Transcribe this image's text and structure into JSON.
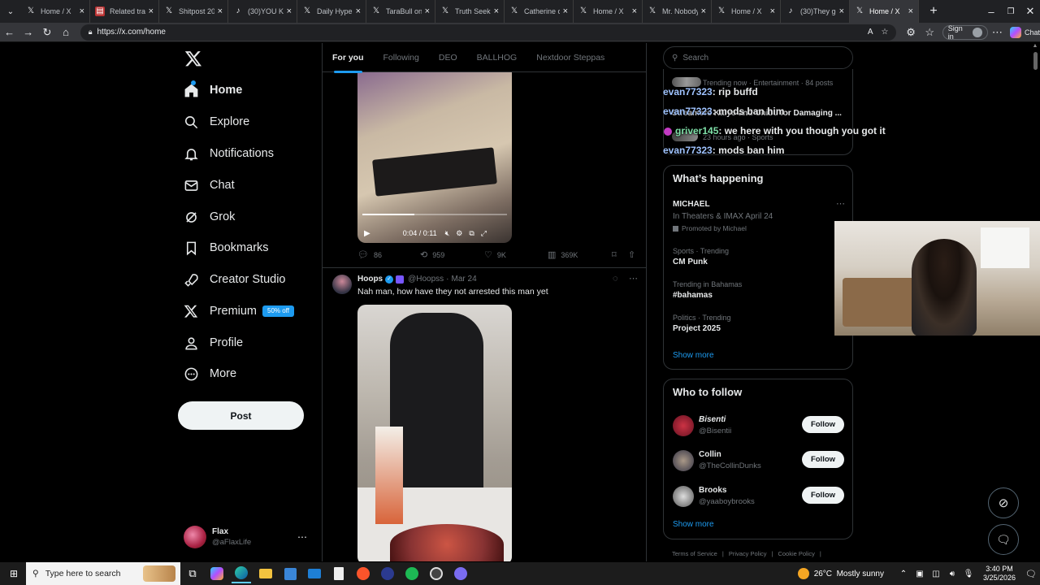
{
  "browser": {
    "tabs": [
      {
        "title": "Home / X",
        "icon": "x-logo-icon"
      },
      {
        "title": "Related track",
        "icon": "page-icon"
      },
      {
        "title": "Shitpost 207",
        "icon": "x-logo-icon"
      },
      {
        "title": "(30)YOU KNO",
        "icon": "tiktok-icon"
      },
      {
        "title": "Daily Hyperp",
        "icon": "x-logo-icon"
      },
      {
        "title": "TaraBull on X",
        "icon": "x-logo-icon"
      },
      {
        "title": "Truth Seeker",
        "icon": "x-logo-icon"
      },
      {
        "title": "Catherine on",
        "icon": "x-logo-icon"
      },
      {
        "title": "Home / X",
        "icon": "x-logo-icon"
      },
      {
        "title": "Mr. Nobody",
        "icon": "x-logo-icon"
      },
      {
        "title": "Home / X",
        "icon": "x-logo-icon"
      },
      {
        "title": "(30)They got",
        "icon": "tiktok-icon"
      },
      {
        "title": "Home / X",
        "icon": "x-logo-icon",
        "active": true
      }
    ],
    "url": "https://x.com/home",
    "sign_in": "Sign in",
    "chat": "Chat"
  },
  "nav": {
    "items": [
      {
        "label": "Home",
        "icon": "home-icon"
      },
      {
        "label": "Explore",
        "icon": "search-icon"
      },
      {
        "label": "Notifications",
        "icon": "bell-icon"
      },
      {
        "label": "Chat",
        "icon": "mail-icon"
      },
      {
        "label": "Grok",
        "icon": "grok-icon"
      },
      {
        "label": "Bookmarks",
        "icon": "bookmark-icon"
      },
      {
        "label": "Creator Studio",
        "icon": "rocket-icon"
      },
      {
        "label": "Premium",
        "icon": "x-logo-icon"
      },
      {
        "label": "Profile",
        "icon": "person-icon"
      },
      {
        "label": "More",
        "icon": "more-circle-icon"
      }
    ],
    "premium_badge": "50% off",
    "post_label": "Post",
    "account": {
      "name": "Flax",
      "handle": "@aFlaxLife"
    }
  },
  "feed": {
    "tabs": [
      "For you",
      "Following",
      "DEO",
      "BALLHOG",
      "Nextdoor Steppas"
    ],
    "video": {
      "time": "0:04 / 0:11",
      "progress": 0.36
    },
    "tweet1_actions": {
      "replies": "86",
      "reposts": "959",
      "likes": "9K",
      "views": "369K"
    },
    "tweet2": {
      "name": "Hoops",
      "handle": "@Hoopss",
      "date": "Mar 24",
      "text": "Nah man, how have they not arrested this man yet"
    }
  },
  "right": {
    "search_placeholder": "Search",
    "top_trend": {
      "meta": "Trending now · Entertainment · 84 posts",
      "title": "Streamers Kaiyo and Chibu for Damaging ...",
      "sub_meta": "23 hours ago · Sports"
    },
    "happening": {
      "title": "What’s happening",
      "promo": {
        "name": "MICHAEL",
        "line": "In Theaters & IMAX April 24",
        "promoted": "Promoted by Michael"
      },
      "trends": [
        {
          "meta": "Sports · Trending",
          "name": "CM Punk"
        },
        {
          "meta": "Trending in Bahamas",
          "name": "#bahamas"
        },
        {
          "meta": "Politics · Trending",
          "name": "Project 2025"
        }
      ],
      "show_more": "Show more"
    },
    "follow": {
      "title": "Who to follow",
      "users": [
        {
          "name": "Bisenti",
          "handle": "@Bisentii"
        },
        {
          "name": "Collin",
          "handle": "@TheCollinDunks"
        },
        {
          "name": "Brooks",
          "handle": "@yaaboybrooks"
        }
      ],
      "button": "Follow",
      "show_more": "Show more"
    },
    "footer": [
      "Terms of Service",
      "Privacy Policy",
      "Cookie Policy"
    ]
  },
  "stream_chat": [
    {
      "user": "evan77323",
      "msg": "rip buffd"
    },
    {
      "user": "evan77323",
      "msg": "mods ban him"
    },
    {
      "user": "griver145",
      "msg": "we here with you though you got it"
    },
    {
      "user": "evan77323",
      "msg": "mods ban him"
    }
  ],
  "taskbar": {
    "search_placeholder": "Type here to search",
    "weather": "26°C  Mostly sunny",
    "time": "3:40 PM",
    "date": "3/25/2026"
  },
  "colors": {
    "accent": "#1d9bf0",
    "background": "#000000",
    "border": "#2f3336",
    "muted": "#71767b"
  }
}
